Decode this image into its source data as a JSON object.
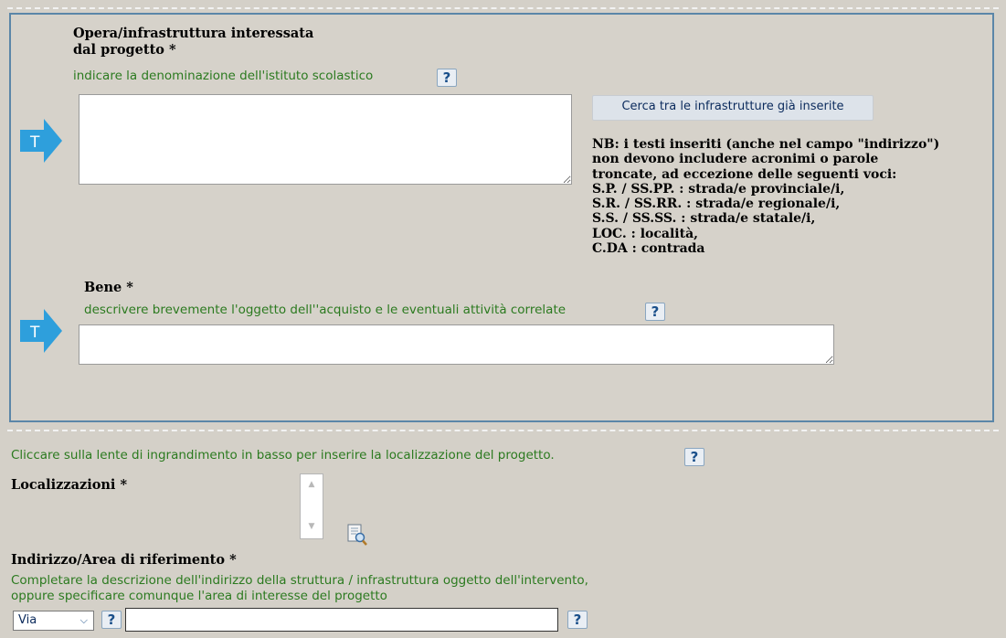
{
  "infra": {
    "label_line1": "Opera/infrastruttura interessata",
    "label_line2": "dal progetto *",
    "hint": "indicare la denominazione dell'istituto scolastico",
    "search_button": "Cerca tra le infrastrutture già inserite",
    "input_value": "",
    "note_lines": [
      "NB: i testi inseriti (anche nel campo \"indirizzo\")",
      "non devono includere acronimi o parole",
      "troncate, ad eccezione delle seguenti voci:",
      "S.P. / SS.PP. : strada/e provinciale/i,",
      "S.R. / SS.RR. : strada/e regionale/i,",
      "S.S. / SS.SS. : strada/e statale/i,",
      "LOC. : località,",
      "C.DA : contrada"
    ]
  },
  "bene": {
    "label": "Bene *",
    "hint": "descrivere brevemente l'oggetto dell''acquisto e le eventuali attività correlate",
    "input_value": ""
  },
  "badge_letter": "T",
  "help_glyph": "?",
  "localization": {
    "hint": "Cliccare sulla lente di ingrandimento in basso per inserire la localizzazione del progetto.",
    "label": "Localizzazioni *",
    "scroll_up": "▲",
    "scroll_down": "▼"
  },
  "address": {
    "label": "Indirizzo/Area di riferimento *",
    "hint_line1": "Completare la descrizione dell'indirizzo della struttura / infrastruttura oggetto dell'intervento,",
    "hint_line2": "oppure specificare comunque l'area di interesse del progetto",
    "type_selected": "Via",
    "type_chevron": "⌵",
    "value": ""
  },
  "colors": {
    "arrow": "#2e9fdc",
    "hint_text": "#2b7a1f",
    "panel_border": "#5b86a8",
    "background": "#d4d0c8"
  },
  "icons": {
    "arrow": "right-arrow-icon",
    "help": "question-mark-icon",
    "lens": "magnifier-document-icon"
  }
}
